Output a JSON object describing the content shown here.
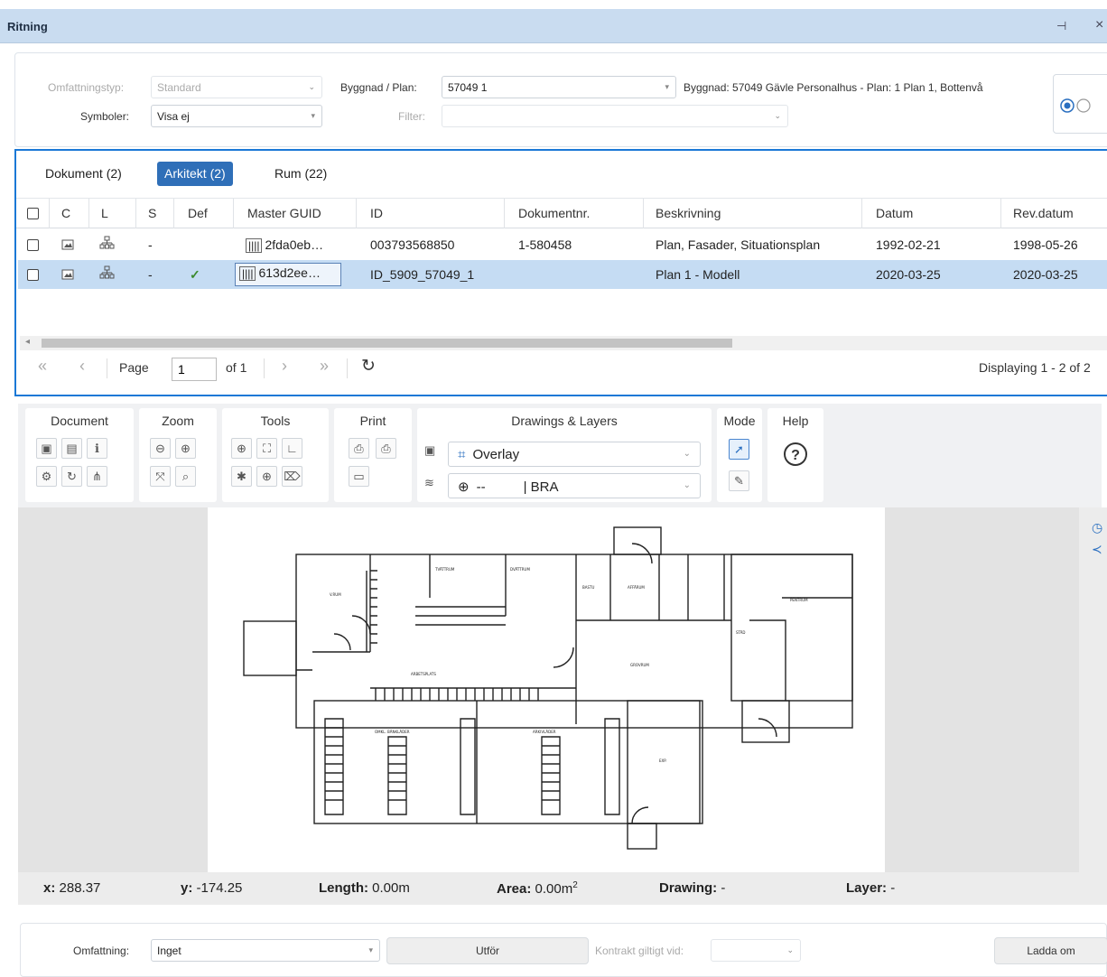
{
  "window": {
    "title": "Ritning",
    "pin_icon": "pin-icon",
    "close_icon": "close-icon"
  },
  "filters": {
    "omfattningstyp_label": "Omfattningstyp:",
    "omfattningstyp_value": "Standard",
    "symboler_label": "Symboler:",
    "symboler_value": "Visa ej",
    "byggnad_label": "Byggnad / Plan:",
    "byggnad_value": "57049 1",
    "byggnad_desc": "Byggnad: 57049  Gävle Personalhus - Plan: 1  Plan 1, Bottenvå",
    "filter_label": "Filter:",
    "filter_value": ""
  },
  "tabs": [
    {
      "label": "Dokument (2)",
      "active": false
    },
    {
      "label": "Arkitekt (2)",
      "active": true
    },
    {
      "label": "Rum (22)",
      "active": false
    }
  ],
  "grid": {
    "columns": [
      "C",
      "L",
      "S",
      "Def",
      "Master GUID",
      "ID",
      "Dokumentnr.",
      "Beskrivning",
      "Datum",
      "Rev.datum"
    ],
    "rows": [
      {
        "s": "-",
        "def": "",
        "guid": "2fda0eb…",
        "id": "003793568850",
        "doknr": "1-580458",
        "beskrivning": "Plan, Fasader, Situationsplan",
        "datum": "1992-02-21",
        "revdatum": "1998-05-26",
        "selected": false
      },
      {
        "s": "-",
        "def": "✓",
        "guid": "613d2ee…",
        "id": "ID_5909_57049_1",
        "doknr": "",
        "beskrivning": "Plan 1 - Modell",
        "datum": "2020-03-25",
        "revdatum": "2020-03-25",
        "selected": true
      }
    ]
  },
  "pager": {
    "first": "«",
    "prev": "‹",
    "page_label": "Page",
    "page_value": "1",
    "of_label": "of 1",
    "next": "›",
    "last": "»",
    "displaying": "Displaying 1 - 2 of 2"
  },
  "toolbar": {
    "document": "Document",
    "zoom": "Zoom",
    "tools": "Tools",
    "print": "Print",
    "drawings_layers": "Drawings & Layers",
    "mode": "Mode",
    "help": "Help",
    "overlay_value": "Overlay",
    "layer_value_left": "--",
    "layer_value_right": "| BRA"
  },
  "status": {
    "x_label": "x:",
    "x_value": "288.37",
    "y_label": "y:",
    "y_value": "-174.25",
    "length_label": "Length:",
    "length_value": "0.00m",
    "area_label": "Area:",
    "area_value": "0.00m",
    "area_sup": "2",
    "drawing_label": "Drawing:",
    "drawing_value": "-",
    "layer_label": "Layer:",
    "layer_value": "-"
  },
  "bottom": {
    "omfattning_label": "Omfattning:",
    "omfattning_value": "Inget",
    "utfor_label": "Utför",
    "kontrakt_label": "Kontrakt giltigt vid:",
    "ladda_label": "Ladda om"
  },
  "plan_labels": [
    "V.RUM",
    "TVÄTTRUM",
    "DVÄTTRUM",
    "BASTU",
    "AFFÄRUM",
    "PENTRUM",
    "ARBETSPLATS",
    "ARKIVÄTSRUM",
    "GROVRUM",
    "OMKL. BÄNKLÄDER",
    "ARKIVLÄDER",
    "EXP.",
    "STÄD"
  ]
}
